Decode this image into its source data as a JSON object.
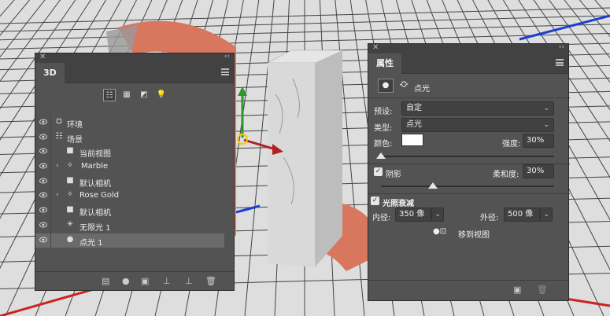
{
  "panel_3d": {
    "tab": "3D",
    "filters": [
      "whole-scene",
      "meshes",
      "materials",
      "lights"
    ],
    "rows": [
      {
        "label": "环境",
        "icon": "environment-icon",
        "twirl": false
      },
      {
        "label": "场景",
        "icon": "scene-icon",
        "twirl": false
      },
      {
        "label": "当前视图",
        "icon": "camera-icon",
        "twirl": false
      },
      {
        "label": "Marble",
        "icon": "mesh-icon",
        "twirl": true
      },
      {
        "label": "默认相机",
        "icon": "camera-icon",
        "twirl": false
      },
      {
        "label": "Rose Gold",
        "icon": "mesh-icon",
        "twirl": true
      },
      {
        "label": "默认相机",
        "icon": "camera-icon",
        "twirl": false
      },
      {
        "label": "无限光 1",
        "icon": "infinite-light-icon",
        "twirl": false
      },
      {
        "label": "点光 1",
        "icon": "point-light-icon",
        "twirl": false,
        "selected": true
      }
    ]
  },
  "properties": {
    "tab": "属性",
    "header_label": "点光",
    "preset_label": "预设:",
    "preset_value": "自定",
    "type_label": "类型:",
    "type_value": "点光",
    "color_label": "颜色:",
    "color_value": "#ffffff",
    "intensity_label": "强度:",
    "intensity_value": "30%",
    "intensity_fraction": 0.0,
    "shadow_label": "阴影",
    "shadow_checked": true,
    "softness_label": "柔和度:",
    "softness_value": "30%",
    "softness_fraction": 0.3,
    "falloff_label": "光照衰减",
    "falloff_checked": true,
    "inner_label": "内径:",
    "inner_value": "350 像",
    "outer_label": "外径:",
    "outer_value": "500 像",
    "move_to_view_label": "移到视图"
  },
  "colors": {
    "panel_bg": "#535353",
    "rose_gold": "#d8765e",
    "axis_red": "#cc2222",
    "axis_blue": "#1a3fd0",
    "axis_green": "#2a9a2a"
  }
}
